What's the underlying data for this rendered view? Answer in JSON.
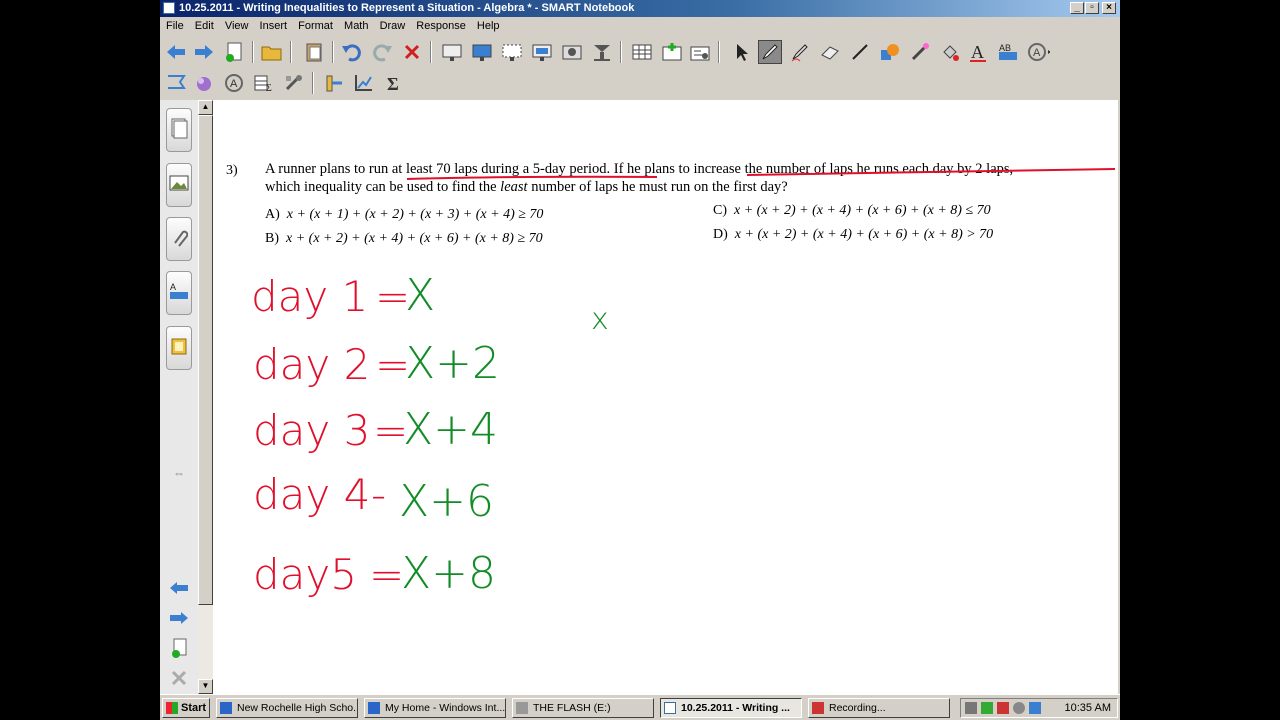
{
  "window": {
    "title": "10.25.2011 - Writing Inequalities to Represent a Situation - Algebra * - SMART Notebook"
  },
  "menu": [
    "File",
    "Edit",
    "View",
    "Insert",
    "Format",
    "Math",
    "Draw",
    "Response",
    "Help"
  ],
  "question": {
    "number": "3)",
    "line1_parts": [
      "A runner plans to run ",
      "at least 70 laps during a 5-day period",
      ". If he plans to ",
      "increase the number of laps he runs each day by 2 laps",
      ","
    ],
    "line2_parts": [
      "which inequality can be used to find the ",
      "least",
      " number of laps he must run on the first day?"
    ],
    "options": [
      {
        "letter": "A)",
        "expr": "x + (x + 1) + (x + 2) + (x + 3) + (x + 4) ≥ 70"
      },
      {
        "letter": "B)",
        "expr": "x + (x + 2) + (x + 4) + (x + 6) + (x + 8) ≥ 70"
      },
      {
        "letter": "C)",
        "expr": "x + (x + 2) + (x + 4) + (x + 6) + (x + 8) ≤ 70"
      },
      {
        "letter": "D)",
        "expr": "x + (x + 2) + (x + 4) + (x + 6) + (x + 8) > 70"
      }
    ]
  },
  "handwriting": [
    {
      "day": "day 1",
      "eq": "=",
      "expr": "X"
    },
    {
      "day": "day 2",
      "eq": "=",
      "expr": "X+2"
    },
    {
      "day": "day 3",
      "eq": "=",
      "expr": "X+4"
    },
    {
      "day": "day 4",
      "eq": "-",
      "expr": "X+6"
    },
    {
      "day": "day5",
      "eq": "=",
      "expr": "X+8"
    }
  ],
  "stray_mark": "x",
  "taskbar": {
    "start": "Start",
    "tasks": [
      "New Rochelle High Scho...",
      "My Home - Windows Int...",
      "THE FLASH (E:)",
      "10.25.2011 - Writing ...",
      "Recording..."
    ],
    "clock": "10:35 AM"
  },
  "colors": {
    "ink_red": "#e0102c",
    "ink_green": "#138c28",
    "underline": "#e0102c"
  },
  "toolbar_icons_row1": [
    "back-arrow-icon",
    "forward-arrow-icon",
    "add-page-icon",
    "open-folder-icon",
    "paste-icon",
    "undo-icon",
    "redo-icon",
    "delete-icon",
    "screen-shade-icon",
    "full-screen-icon",
    "transparent-background-icon",
    "show-hide-icon",
    "capture-icon",
    "document-camera-icon",
    "table-icon",
    "insert-response-icon",
    "activity-builder-icon",
    "select-icon",
    "pen-icon",
    "creative-pen-icon",
    "eraser-icon",
    "line-icon",
    "shapes-icon",
    "magic-pen-icon",
    "fill-icon",
    "text-icon",
    "properties-icon",
    "more-tools-icon"
  ],
  "toolbar_icons_row2": [
    "lines-icon",
    "fill-color-icon",
    "font-icon",
    "table-format-icon",
    "tools-icon",
    "measurement-icon",
    "graph-icon",
    "sigma-icon"
  ],
  "sidebar_icons": [
    "page-sorter-icon",
    "gallery-icon",
    "attachments-icon",
    "properties-icon",
    "addons-icon"
  ]
}
